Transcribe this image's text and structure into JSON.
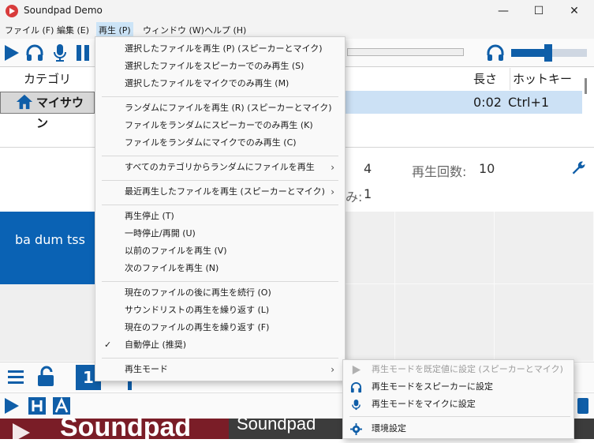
{
  "window": {
    "title": "Soundpad Demo",
    "minimize": "—",
    "maximize": "☐",
    "close": "✕"
  },
  "menubar": [
    {
      "label": "ファイル (F)"
    },
    {
      "label": "編集 (E)"
    },
    {
      "label": "再生 (P)"
    },
    {
      "label": "ウィンドウ (W)"
    },
    {
      "label": "ヘルプ (H)"
    }
  ],
  "categories": {
    "header": "カテゴリ",
    "items": [
      {
        "label": "マイサウン"
      }
    ]
  },
  "filelist": {
    "headers": {
      "length": "長さ",
      "hotkey": "ホットキー"
    },
    "rows": [
      {
        "length": "0:02",
        "hotkey": "Ctrl+1"
      }
    ]
  },
  "stats": {
    "count_value": "4",
    "play_count_label": "再生回数:",
    "play_count_value": "10",
    "partial_label": "み:",
    "partial_value": "1"
  },
  "tiles": {
    "sound_label": "ba dum tss"
  },
  "bottombar": {
    "page_number": "1"
  },
  "banner": {
    "text1": "Soundpad",
    "text2": "Soundpad"
  },
  "play_menu": {
    "items": [
      {
        "label": "選択したファイルを再生 (P) (スピーカーとマイク)"
      },
      {
        "label": "選択したファイルをスピーカーでのみ再生 (S)"
      },
      {
        "label": "選択したファイルをマイクでのみ再生 (M)"
      },
      {
        "label": "ランダムにファイルを再生 (R) (スピーカーとマイク)"
      },
      {
        "label": "ファイルをランダムにスピーカーでのみ再生 (K)"
      },
      {
        "label": "ファイルをランダムにマイクでのみ再生 (C)"
      },
      {
        "label": "すべてのカテゴリからランダムにファイルを再生"
      },
      {
        "label": "最近再生したファイルを再生 (スピーカーとマイク)"
      },
      {
        "label": "再生停止 (T)"
      },
      {
        "label": "一時停止/再開 (U)"
      },
      {
        "label": "以前のファイルを再生 (V)"
      },
      {
        "label": "次のファイルを再生 (N)"
      },
      {
        "label": "現在のファイルの後に再生を続行 (O)"
      },
      {
        "label": "サウンドリストの再生を繰り返す (L)"
      },
      {
        "label": "現在のファイルの再生を繰り返す (F)"
      },
      {
        "label": "自動停止 (推奨)",
        "checked": true
      },
      {
        "label": "再生モード"
      }
    ],
    "submenu_arrow": "›",
    "check_mark": "✓"
  },
  "playmode_submenu": {
    "items": [
      {
        "label": "再生モードを既定値に設定 (スピーカーとマイク)",
        "disabled": true,
        "icon": "play-icon"
      },
      {
        "label": "再生モードをスピーカーに設定",
        "icon": "headphones-icon"
      },
      {
        "label": "再生モードをマイクに設定",
        "icon": "microphone-icon"
      },
      {
        "label": "環境設定",
        "icon": "gear-icon"
      }
    ]
  },
  "colors": {
    "accent": "#0f5ea8",
    "selection": "#cce1f5",
    "menu_highlight": "#cce4f7"
  }
}
